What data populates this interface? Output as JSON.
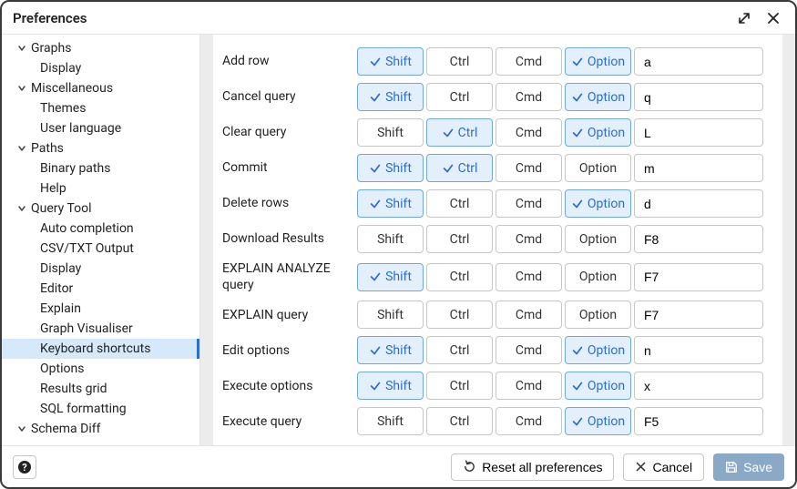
{
  "title": "Preferences",
  "sidebar": {
    "groups": [
      {
        "label": "Graphs",
        "items": [
          "Display"
        ],
        "selected": -1
      },
      {
        "label": "Miscellaneous",
        "items": [
          "Themes",
          "User language"
        ],
        "selected": -1
      },
      {
        "label": "Paths",
        "items": [
          "Binary paths",
          "Help"
        ],
        "selected": -1
      },
      {
        "label": "Query Tool",
        "items": [
          "Auto completion",
          "CSV/TXT Output",
          "Display",
          "Editor",
          "Explain",
          "Graph Visualiser",
          "Keyboard shortcuts",
          "Options",
          "Results grid",
          "SQL formatting"
        ],
        "selected": 6
      },
      {
        "label": "Schema Diff",
        "items": [],
        "selected": -1
      }
    ]
  },
  "modifiers": {
    "shift": "Shift",
    "ctrl": "Ctrl",
    "cmd": "Cmd",
    "option": "Option"
  },
  "rows": [
    {
      "label": "Add row",
      "shift": true,
      "ctrl": false,
      "cmd": false,
      "option": true,
      "key": "a"
    },
    {
      "label": "Cancel query",
      "shift": true,
      "ctrl": false,
      "cmd": false,
      "option": true,
      "key": "q"
    },
    {
      "label": "Clear query",
      "shift": false,
      "ctrl": true,
      "cmd": false,
      "option": true,
      "key": "L"
    },
    {
      "label": "Commit",
      "shift": true,
      "ctrl": true,
      "cmd": false,
      "option": false,
      "key": "m"
    },
    {
      "label": "Delete rows",
      "shift": true,
      "ctrl": false,
      "cmd": false,
      "option": true,
      "key": "d"
    },
    {
      "label": "Download Results",
      "shift": false,
      "ctrl": false,
      "cmd": false,
      "option": false,
      "key": "F8"
    },
    {
      "label": "EXPLAIN ANALYZE query",
      "shift": true,
      "ctrl": false,
      "cmd": false,
      "option": false,
      "key": "F7"
    },
    {
      "label": "EXPLAIN query",
      "shift": false,
      "ctrl": false,
      "cmd": false,
      "option": false,
      "key": "F7"
    },
    {
      "label": "Edit options",
      "shift": true,
      "ctrl": false,
      "cmd": false,
      "option": true,
      "key": "n"
    },
    {
      "label": "Execute options",
      "shift": true,
      "ctrl": false,
      "cmd": false,
      "option": true,
      "key": "x"
    },
    {
      "label": "Execute query",
      "shift": false,
      "ctrl": false,
      "cmd": false,
      "option": true,
      "key": "F5"
    }
  ],
  "footer": {
    "reset": "Reset all preferences",
    "cancel": "Cancel",
    "save": "Save"
  }
}
